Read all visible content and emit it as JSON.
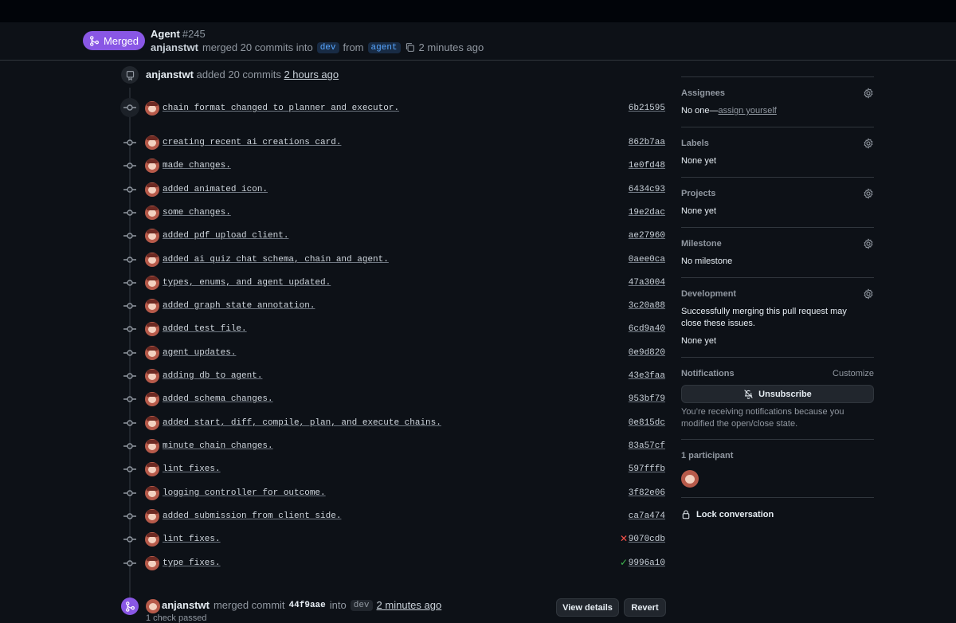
{
  "header": {
    "badge_label": "Merged",
    "title": "Agent",
    "number": "#245",
    "author": "anjanstwt",
    "action_text": "merged 20 commits into",
    "base_branch": "dev",
    "from_text": "from",
    "head_branch": "agent",
    "time": "2 minutes ago"
  },
  "timeline": {
    "added_event": {
      "author": "anjanstwt",
      "text": "added 20 commits",
      "time": "2 hours ago"
    },
    "commits": [
      {
        "message": "chain format changed to planner and executor.",
        "sha": "6b21595",
        "status": ""
      },
      {
        "message": "creating recent ai creations card.",
        "sha": "862b7aa",
        "status": ""
      },
      {
        "message": "made changes.",
        "sha": "1e0fd48",
        "status": ""
      },
      {
        "message": "added animated icon.",
        "sha": "6434c93",
        "status": ""
      },
      {
        "message": "some changes.",
        "sha": "19e2dac",
        "status": ""
      },
      {
        "message": "added pdf upload client.",
        "sha": "ae27960",
        "status": ""
      },
      {
        "message": "added ai quiz chat schema, chain and agent.",
        "sha": "0aee0ca",
        "status": ""
      },
      {
        "message": "types, enums, and agent updated.",
        "sha": "47a3004",
        "status": ""
      },
      {
        "message": "added graph state annotation.",
        "sha": "3c20a88",
        "status": ""
      },
      {
        "message": "added test file.",
        "sha": "6cd9a40",
        "status": ""
      },
      {
        "message": "agent updates.",
        "sha": "0e9d820",
        "status": ""
      },
      {
        "message": "adding db to agent.",
        "sha": "43e3faa",
        "status": ""
      },
      {
        "message": "added schema changes.",
        "sha": "953bf79",
        "status": ""
      },
      {
        "message": "added start, diff, compile, plan, and execute chains.",
        "sha": "0e815dc",
        "status": ""
      },
      {
        "message": "minute chain changes.",
        "sha": "83a57cf",
        "status": ""
      },
      {
        "message": "lint fixes.",
        "sha": "597fffb",
        "status": ""
      },
      {
        "message": "logging controller for outcome.",
        "sha": "3f82e06",
        "status": ""
      },
      {
        "message": "added submission from client side.",
        "sha": "ca7a474",
        "status": ""
      },
      {
        "message": "lint fixes.",
        "sha": "9070cdb",
        "status": "fail"
      },
      {
        "message": "type fixes.",
        "sha": "9996a10",
        "status": "pass"
      }
    ],
    "merge_event": {
      "author": "anjanstwt",
      "text": "merged commit",
      "commit": "44f9aae",
      "into": "into",
      "branch": "dev",
      "time": "2 minutes ago",
      "checks": "1 check passed",
      "view_details": "View details",
      "revert": "Revert"
    }
  },
  "sidebar": {
    "assignees": {
      "title": "Assignees",
      "value_prefix": "No one—",
      "link": "assign yourself"
    },
    "labels": {
      "title": "Labels",
      "value": "None yet"
    },
    "projects": {
      "title": "Projects",
      "value": "None yet"
    },
    "milestone": {
      "title": "Milestone",
      "value": "No milestone"
    },
    "development": {
      "title": "Development",
      "description": "Successfully merging this pull request may close these issues.",
      "value": "None yet"
    },
    "notifications": {
      "title": "Notifications",
      "customize": "Customize",
      "button": "Unsubscribe",
      "description": "You’re receiving notifications because you modified the open/close state."
    },
    "participants": {
      "title": "1 participant"
    },
    "lock": {
      "label": "Lock conversation"
    }
  },
  "colors": {
    "merged": "#8957e5",
    "link": "#58a6ff",
    "fail": "#f85149",
    "pass": "#3fb950"
  }
}
